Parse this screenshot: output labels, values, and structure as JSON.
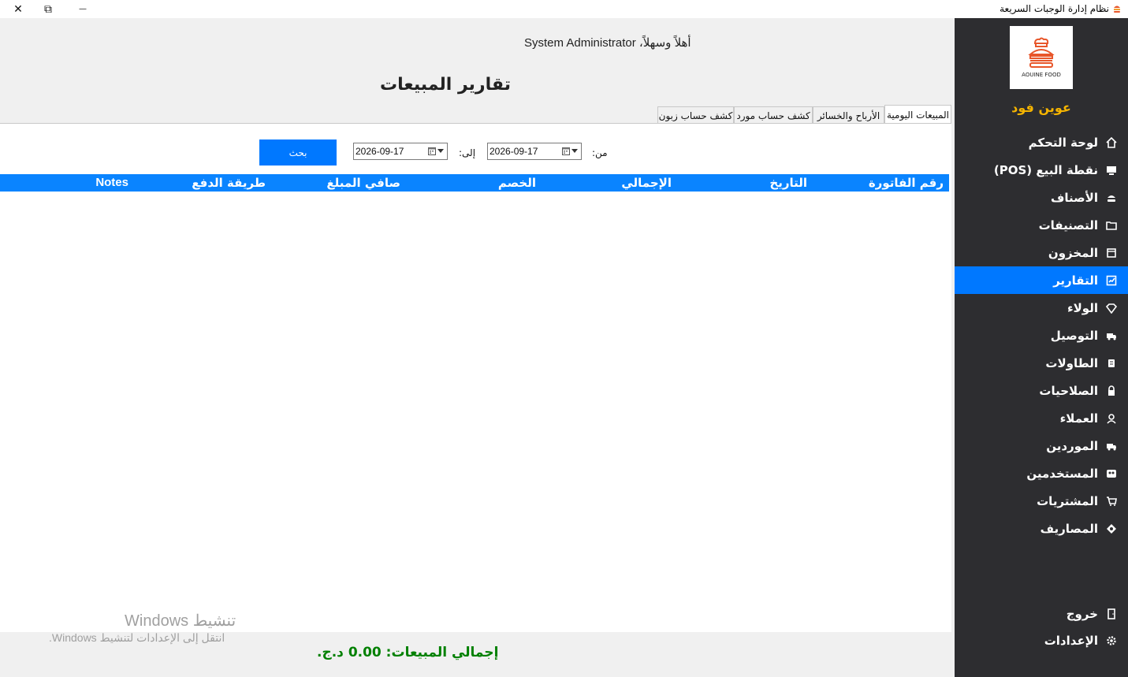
{
  "window": {
    "title": "نظام إدارة الوجبات السريعة",
    "close_glyph": "✕",
    "restore_glyph": "⧉",
    "minimize_glyph": "—"
  },
  "sidebar": {
    "logo_caption": "AOUINE FOOD",
    "brand": "عوين فود",
    "active_color": "#0078ff",
    "items": [
      {
        "label": "لوحة التحكم",
        "icon": "home-icon"
      },
      {
        "label": "نقطة البيع (POS)",
        "icon": "monitor-icon"
      },
      {
        "label": "الأصناف",
        "icon": "burger-icon"
      },
      {
        "label": "التصنيفات",
        "icon": "folder-icon"
      },
      {
        "label": "المخزون",
        "icon": "box-icon"
      },
      {
        "label": "التقارير",
        "icon": "chart-icon",
        "active": true
      },
      {
        "label": "الولاء",
        "icon": "diamond-icon"
      },
      {
        "label": "التوصيل",
        "icon": "truck-icon"
      },
      {
        "label": "الطاولات",
        "icon": "table-icon"
      },
      {
        "label": "الصلاحيات",
        "icon": "lock-icon"
      },
      {
        "label": "العملاء",
        "icon": "user-icon"
      },
      {
        "label": "الموردين",
        "icon": "supplier-truck-icon"
      },
      {
        "label": "المستخدمين",
        "icon": "users-icon"
      },
      {
        "label": "المشتريات",
        "icon": "cart-icon"
      },
      {
        "label": "المصاريف",
        "icon": "money-icon"
      }
    ],
    "logout": {
      "label": "خروج",
      "icon": "door-icon"
    },
    "settings": {
      "label": "الإعدادات",
      "icon": "gear-icon"
    }
  },
  "header": {
    "welcome": "أهلاً وسهلاً، System Administrator",
    "page_title": "تقارير المبيعات"
  },
  "tabs": [
    {
      "label": "المبيعات اليومية",
      "active": true
    },
    {
      "label": "الأرباح والخسائر"
    },
    {
      "label": "كشف حساب مورد"
    },
    {
      "label": "كشف حساب زبون"
    }
  ],
  "filters": {
    "from_label": "من:",
    "from_date": "2026-09-17",
    "to_label": "إلى:",
    "to_date": "2026-09-17",
    "search_label": "بحث"
  },
  "grid": {
    "header_color": "#0a84ff",
    "columns": [
      "رقم الفاتورة",
      "التاريخ",
      "الإجمالي",
      "الخصم",
      "صافي المبلغ",
      "طريقة الدفع",
      "Notes"
    ],
    "rows": []
  },
  "footer": {
    "total": "إجمالي المبيعات: 0.00 د.ج."
  },
  "watermark": {
    "line1": "تنشيط Windows",
    "line2": "انتقل إلى الإعدادات لتنشيط Windows."
  }
}
